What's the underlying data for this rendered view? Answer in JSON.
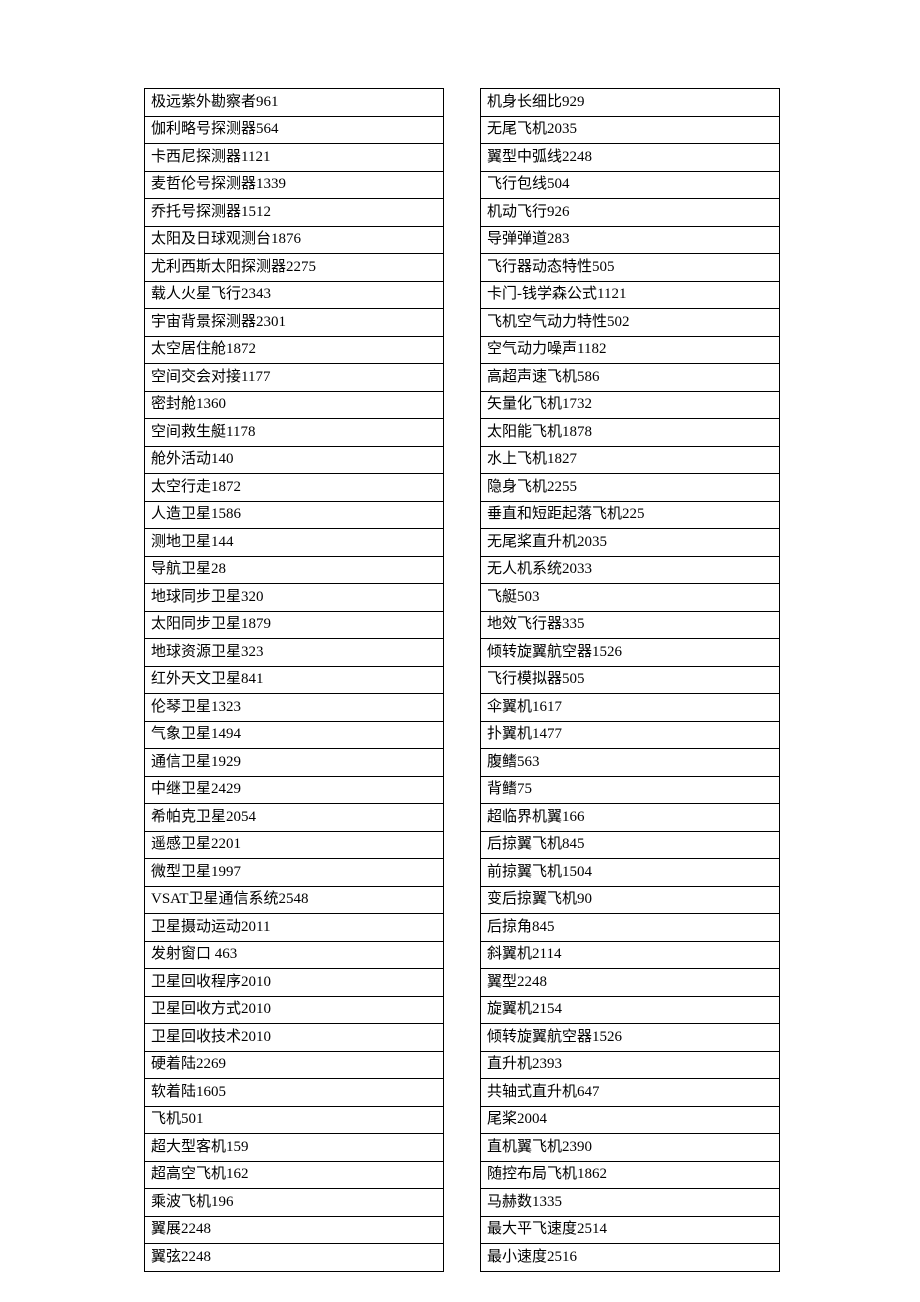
{
  "left_column": [
    "极远紫外勘察者961",
    "伽利略号探测器564",
    "卡西尼探测器1121",
    "麦哲伦号探测器1339",
    "乔托号探测器1512",
    "太阳及日球观测台1876",
    "尤利西斯太阳探测器2275",
    "载人火星飞行2343",
    "宇宙背景探测器2301",
    "太空居住舱1872",
    "空间交会对接1177",
    "密封舱1360",
    "空间救生艇1178",
    "舱外活动140",
    "太空行走1872",
    "人造卫星1586",
    "测地卫星144",
    "导航卫星28",
    "地球同步卫星320",
    "太阳同步卫星1879",
    "地球资源卫星323",
    "红外天文卫星841",
    "伦琴卫星1323",
    "气象卫星1494",
    "通信卫星1929",
    "中继卫星2429",
    "希帕克卫星2054",
    "遥感卫星2201",
    "微型卫星1997",
    "VSAT卫星通信系统2548",
    "卫星摄动运动2011",
    "发射窗口  463",
    "卫星回收程序2010",
    "卫星回收方式2010",
    "卫星回收技术2010",
    "硬着陆2269",
    "软着陆1605",
    "飞机501",
    "超大型客机159",
    "超高空飞机162",
    "乘波飞机196",
    "翼展2248",
    "翼弦2248"
  ],
  "right_column": [
    "机身长细比929",
    "无尾飞机2035",
    "翼型中弧线2248",
    "飞行包线504",
    "机动飞行926",
    "导弹弹道283",
    "飞行器动态特性505",
    "卡门-钱学森公式1121",
    "飞机空气动力特性502",
    "空气动力噪声1182",
    "高超声速飞机586",
    "矢量化飞机1732",
    "太阳能飞机1878",
    "水上飞机1827",
    "隐身飞机2255",
    "垂直和短距起落飞机225",
    "无尾桨直升机2035",
    "无人机系统2033",
    "飞艇503",
    "地效飞行器335",
    "倾转旋翼航空器1526",
    "飞行模拟器505",
    "伞翼机1617",
    "扑翼机1477",
    "腹鳍563",
    "背鳍75",
    "超临界机翼166",
    "后掠翼飞机845",
    "前掠翼飞机1504",
    "变后掠翼飞机90",
    "后掠角845",
    "斜翼机2114",
    "翼型2248",
    "旋翼机2154",
    "倾转旋翼航空器1526",
    "直升机2393",
    "共轴式直升机647",
    "尾桨2004",
    "直机翼飞机2390",
    "随控布局飞机1862",
    "马赫数1335",
    "最大平飞速度2514",
    "最小速度2516"
  ]
}
